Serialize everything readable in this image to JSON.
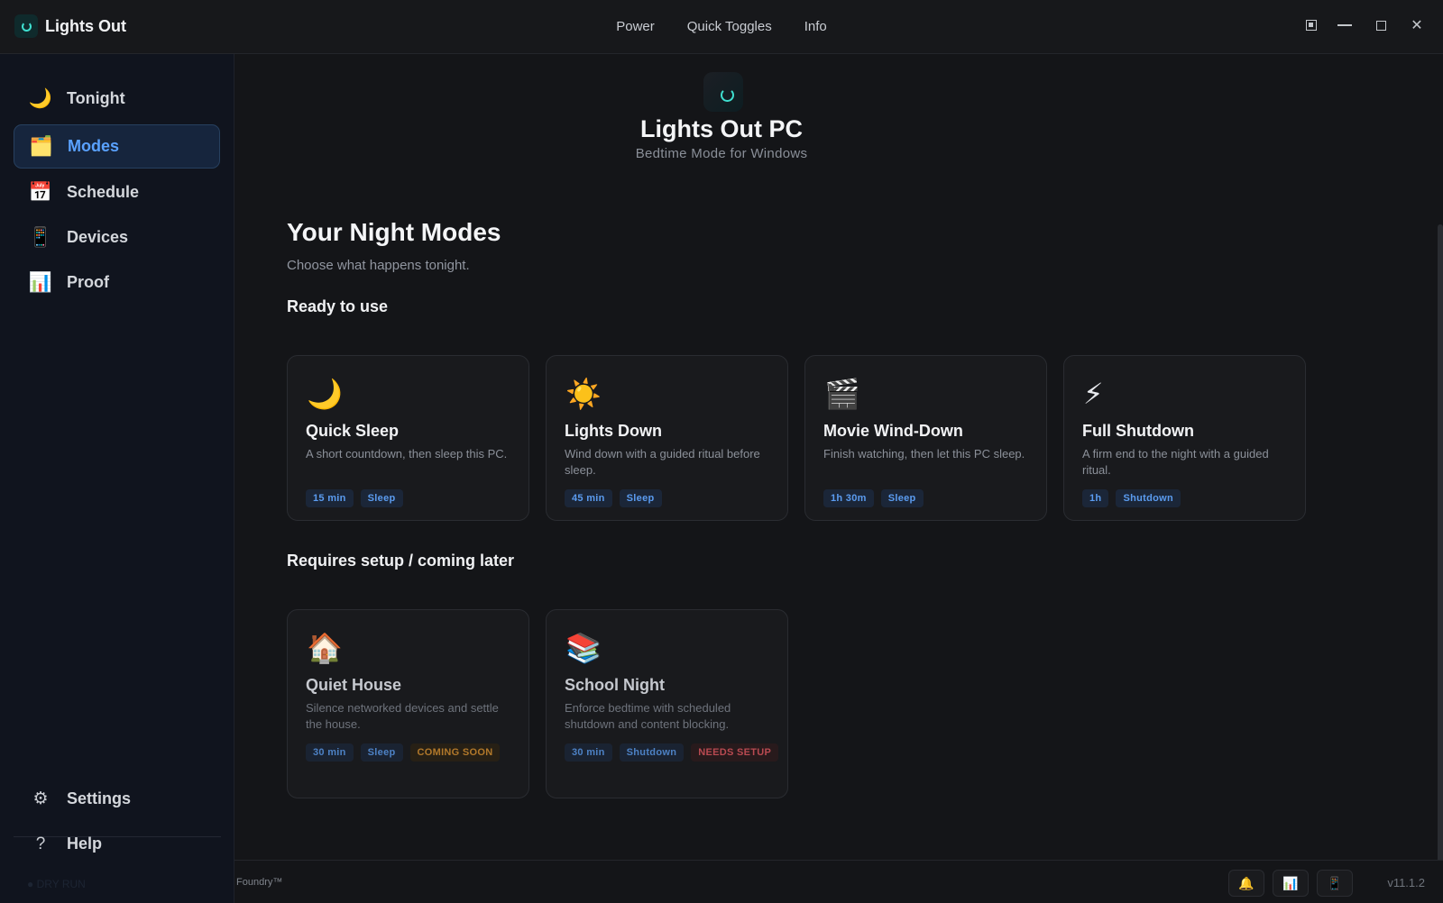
{
  "app": {
    "title": "Lights Out"
  },
  "top_nav": [
    "Power",
    "Quick Toggles",
    "Info"
  ],
  "sidebar": {
    "items": [
      {
        "label": "Tonight",
        "icon": "🌙"
      },
      {
        "label": "Modes",
        "icon": "🗂️"
      },
      {
        "label": "Schedule",
        "icon": "📅"
      },
      {
        "label": "Devices",
        "icon": "📱"
      },
      {
        "label": "Proof",
        "icon": "📊"
      }
    ],
    "bottom": [
      {
        "label": "Settings",
        "icon": "⚙"
      },
      {
        "label": "Help",
        "icon": "?"
      }
    ],
    "status": "● DRY RUN"
  },
  "hero": {
    "title": "Lights Out PC",
    "subtitle": "Bedtime Mode for Windows"
  },
  "page": {
    "title": "Your Night Modes",
    "subtitle": "Choose what happens tonight."
  },
  "sections": {
    "ready": "Ready to use",
    "later": "Requires setup / coming later"
  },
  "ready_cards": [
    {
      "icon": "🌙",
      "title": "Quick Sleep",
      "desc": "A short countdown, then sleep this PC.",
      "tags": [
        "15 min",
        "Sleep"
      ]
    },
    {
      "icon": "☀️",
      "title": "Lights Down",
      "desc": "Wind down with a guided ritual before sleep.",
      "tags": [
        "45 min",
        "Sleep"
      ]
    },
    {
      "icon": "🎬",
      "title": "Movie Wind-Down",
      "desc": "Finish watching, then let this PC sleep.",
      "tags": [
        "1h 30m",
        "Sleep"
      ]
    },
    {
      "icon": "⚡",
      "title": "Full Shutdown",
      "desc": "A firm end to the night with a guided ritual.",
      "tags": [
        "1h",
        "Shutdown"
      ]
    }
  ],
  "later_cards": [
    {
      "icon": "🏠",
      "title": "Quiet House",
      "desc": "Silence networked devices and settle the house.",
      "tags": [
        "30 min",
        "Sleep"
      ],
      "badge": "COMING SOON"
    },
    {
      "icon": "📚",
      "title": "School Night",
      "desc": "Enforce bedtime with scheduled shutdown and content blocking.",
      "tags": [
        "30 min",
        "Shutdown"
      ],
      "badge": "NEEDS SETUP"
    }
  ],
  "statusbar": {
    "foundry": "Foundry™",
    "buttons": [
      "🔔",
      "📊",
      "📱"
    ],
    "version": "v11.1.2"
  },
  "colors": {
    "accent": "#5aa2ff",
    "teal": "#3fe0d0",
    "warning": "#d8902e",
    "danger": "#e0565e"
  }
}
